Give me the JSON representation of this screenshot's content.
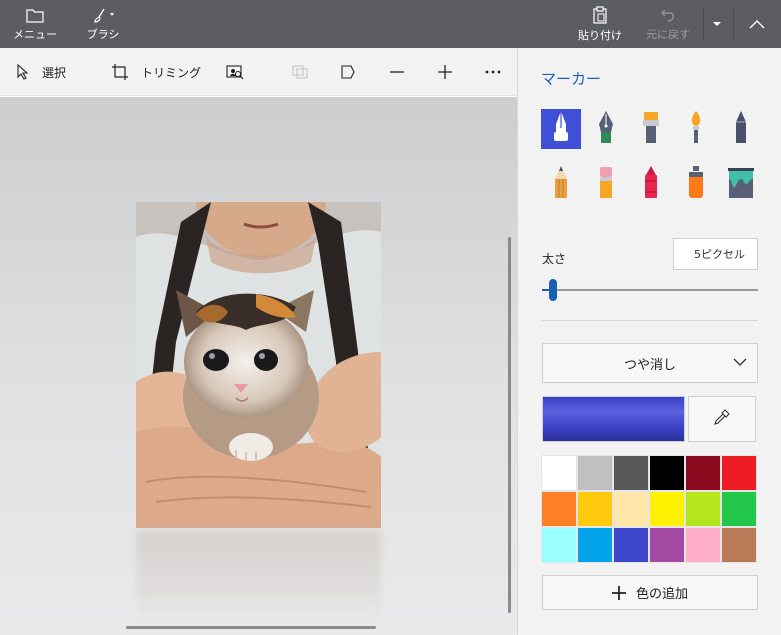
{
  "titlebar": {
    "menu": {
      "label": "メニュー",
      "icon": "folder-icon"
    },
    "brush": {
      "label": "ブラシ",
      "icon": "brush-icon"
    },
    "paste": {
      "label": "貼り付け",
      "icon": "paste-icon"
    },
    "undo": {
      "label": "元に戻す",
      "icon": "undo-icon"
    },
    "history_icon": "chevron-down-icon",
    "collapse_icon": "chevron-up-icon"
  },
  "toolbar": {
    "select": {
      "label": "選択",
      "icon": "cursor-icon"
    },
    "crop": {
      "label": "トリミング",
      "icon": "crop-icon"
    },
    "magic_select_icon": "magic-select-icon",
    "stickers_icon": "stickers-icon",
    "flag_icon": "flag-icon",
    "line_icon": "minus-icon",
    "add_icon": "plus-icon",
    "more_icon": "more-icon"
  },
  "panel": {
    "title": "マーカー",
    "brushes": [
      {
        "name": "calligraphy-pen",
        "color": "#ffffff"
      },
      {
        "name": "fountain-pen",
        "color": "#2e8b57"
      },
      {
        "name": "marker",
        "color": "#f5a623"
      },
      {
        "name": "oil-brush",
        "color": "#f5a623"
      },
      {
        "name": "crayon-dark",
        "color": "#4a4f6a"
      },
      {
        "name": "pencil",
        "color": "#e8a040"
      },
      {
        "name": "eraser",
        "color": "#f19fb0"
      },
      {
        "name": "crayon",
        "color": "#e8264d"
      },
      {
        "name": "spray-can",
        "color": "#ff7a1a"
      },
      {
        "name": "fill-bucket",
        "color": "#3fbfa8"
      }
    ],
    "thickness_label": "太さ",
    "thickness_value": "5ピクセル",
    "thickness_fraction": 0.05,
    "finish_selected": "つや消し",
    "current_color": "#3a41c6",
    "palette": [
      "#ffffff",
      "#c0c0c0",
      "#595959",
      "#000000",
      "#8b0a1e",
      "#ed1c24",
      "#ff7f27",
      "#ffc90e",
      "#ffe6a8",
      "#fff200",
      "#b5e61d",
      "#22c74a",
      "#99ffff",
      "#00a2e8",
      "#3f48cc",
      "#a349a4",
      "#ffaec9",
      "#b97a57"
    ],
    "add_color_label": "色の追加"
  }
}
